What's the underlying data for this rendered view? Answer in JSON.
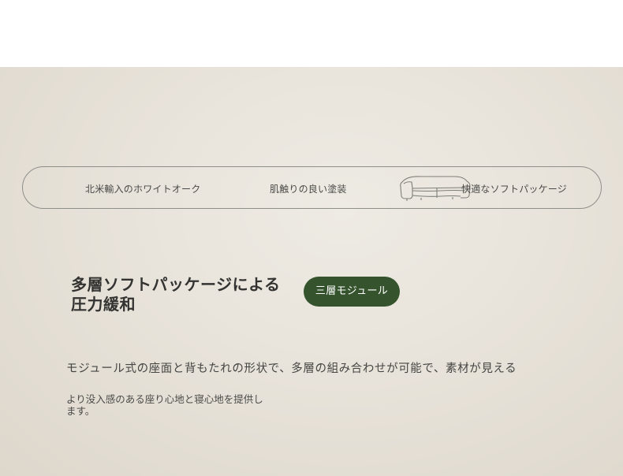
{
  "features": {
    "items": [
      {
        "label": "北米輸入のホワイトオーク"
      },
      {
        "label": "肌触りの良い塗装"
      },
      {
        "label": "快適なソフトパッケージ"
      }
    ],
    "icon": "sofa-icon"
  },
  "main": {
    "headline": "多層ソフトパッケージによる圧力緩和",
    "badge": "三層モジュール",
    "description": "モジュール式の座面と背もたれの形状で、多層の組み合わせが可能で、素材が見える",
    "subtext": "より没入感のある座り心地と寝心地を提供します。"
  },
  "colors": {
    "background": "#e8e3da",
    "badge": "#35542e",
    "text": "#333331"
  }
}
